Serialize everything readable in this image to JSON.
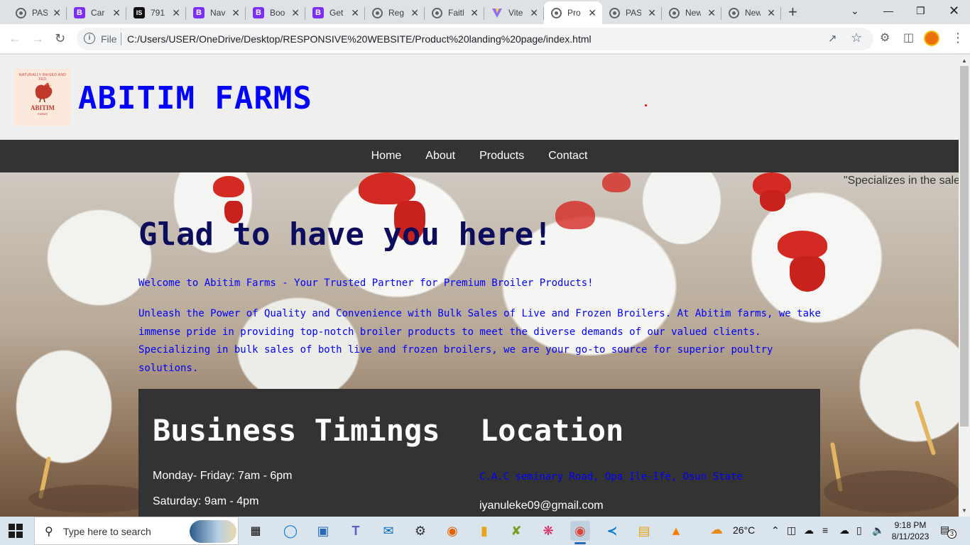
{
  "browser": {
    "tabs": [
      {
        "label": "PAS",
        "icon": "globe-icon"
      },
      {
        "label": "Car",
        "icon": "bootstrap-icon"
      },
      {
        "label": "791",
        "icon": "is-icon"
      },
      {
        "label": "Nav",
        "icon": "bootstrap-icon"
      },
      {
        "label": "Boo",
        "icon": "bootstrap-icon"
      },
      {
        "label": "Get",
        "icon": "bootstrap-icon"
      },
      {
        "label": "Reg",
        "icon": "globe-icon"
      },
      {
        "label": "Faith",
        "icon": "globe-icon"
      },
      {
        "label": "Vite",
        "icon": "vite-icon"
      },
      {
        "label": "Pro",
        "icon": "globe-icon",
        "active": true
      },
      {
        "label": "PAS",
        "icon": "globe-icon"
      },
      {
        "label": "New",
        "icon": "globe-icon"
      },
      {
        "label": "New",
        "icon": "globe-icon"
      }
    ],
    "new_tab": "+",
    "omnibox": {
      "scheme_label": "File",
      "url": "C:/Users/USER/OneDrive/Desktop/RESPONSIVE%20WEBSITE/Product%20landing%20page/index.html"
    }
  },
  "site": {
    "brand": "ABITIM FARMS",
    "logo": {
      "ring_text": "NATURALLY RAISED AND FED",
      "name": "ABITIM",
      "sub": "FARMS"
    },
    "nav": [
      "Home",
      "About",
      "Products",
      "Contact"
    ],
    "marquee": "\"Specializes in the sale",
    "hero": {
      "title": "Glad to have you here!",
      "welcome": "Welcome to Abitim Farms - Your Trusted Partner for Premium Broiler Products!",
      "body": "Unleash the Power of Quality and Convenience with Bulk Sales of Live and Frozen Broilers. At Abitim farms, we take immense pride in providing top-notch broiler products to meet the diverse demands of our valued clients. Specializing in bulk sales of both live and frozen broilers, we are your go-to source for superior poultry solutions."
    },
    "timings": {
      "title": "Business Timings",
      "lines": [
        "Monday- Friday: 7am - 6pm",
        "Saturday: 9am - 4pm"
      ]
    },
    "location": {
      "title": "Location",
      "address": "C.A.C seminary Road, Opa Ile-Ife, Osun State",
      "email": "iyanuleke09@gmail.com"
    }
  },
  "taskbar": {
    "search_placeholder": "Type here to search",
    "weather": "26°C",
    "time": "9:18 PM",
    "date": "8/11/2023",
    "notifications": "3"
  },
  "colors": {
    "brand_blue": "#0000ff",
    "title_navy": "#0d0d5e",
    "nav_dark": "#333333"
  }
}
